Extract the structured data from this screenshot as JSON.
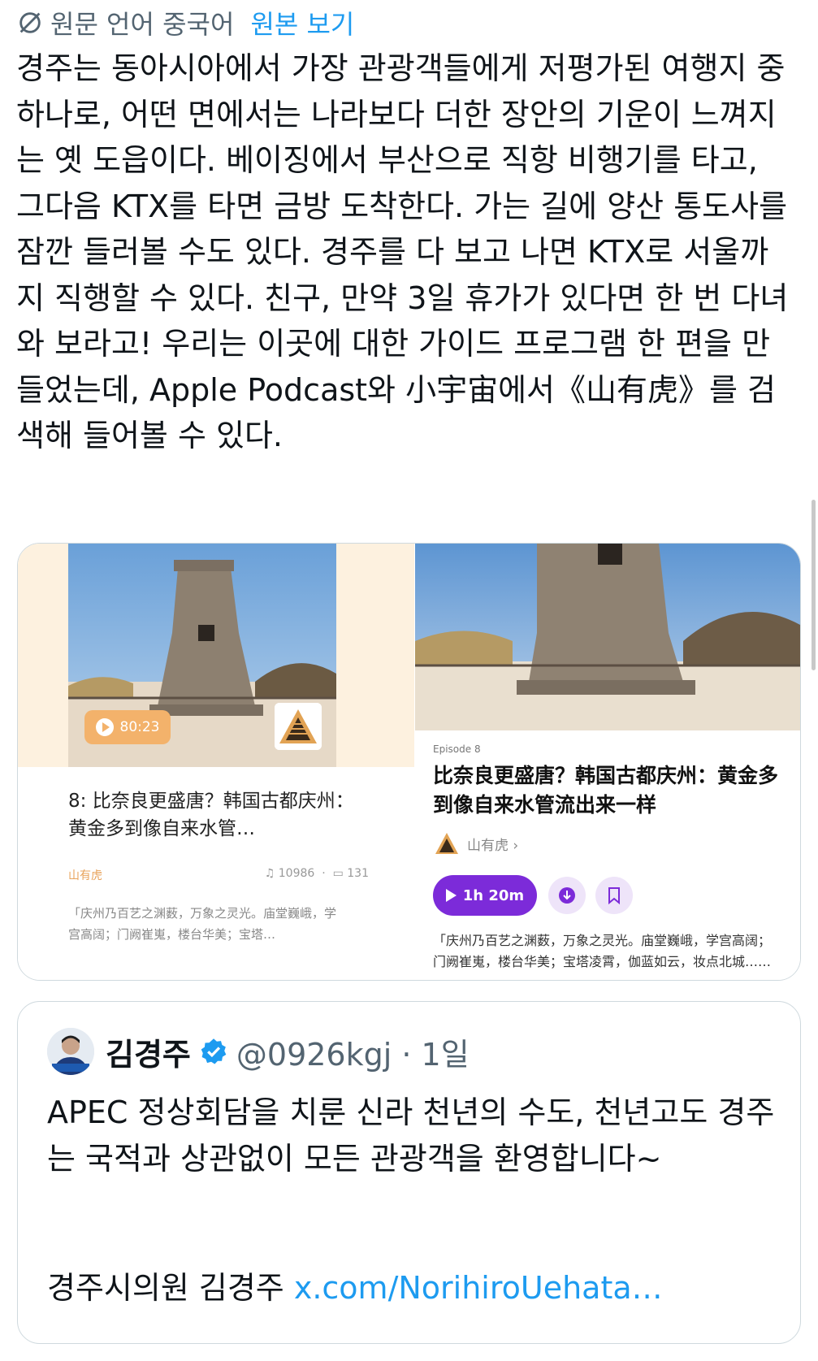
{
  "translation_bar": {
    "label": "원문 언어 중국어",
    "show_original": "원본 보기"
  },
  "post": {
    "text": "경주는 동아시아에서 가장 관광객들에게 저평가된 여행지 중 하나로, 어떤 면에서는 나라보다 더한 장안의 기운이 느껴지는 옛 도읍이다. 베이징에서 부산으로 직항 비행기를 타고, 그다음 KTX를 타면 금방 도착한다. 가는 길에 양산 통도사를 잠깐 들러볼 수도 있다. 경주를 다 보고 나면 KTX로 서울까지 직행할 수 있다. 친구, 만약 3일 휴가가 있다면 한 번 다녀와 보라고! 우리는 이곳에 대한 가이드 프로그램 한 편을 만들었는데, Apple Podcast와 小宇宙에서《山有虎》를 검색해 들어볼 수 있다."
  },
  "media": {
    "left": {
      "duration": "80:23",
      "title": "8: 比奈良更盛唐？韩国古都庆州：黄金多到像自来水管…",
      "brand": "山有虎",
      "listens": "10986",
      "comments": "131",
      "snippet": "「庆州乃百艺之渊薮，万象之灵光。庙堂巍峨，学宫高阔；门阙崔嵬，楼台华美；宝塔…"
    },
    "right": {
      "episode": "Episode 8",
      "title": "比奈良更盛唐？韩国古都庆州：黄金多到像自来水管流出来一样",
      "channel": "山有虎 ›",
      "play_label": "1h 20m",
      "snippet": "「庆州乃百艺之渊薮，万象之灵光。庙堂巍峨，学宫高阔；门阙崔嵬，楼台华美；宝塔凌霄，伽蓝如云，妆点北城……"
    }
  },
  "quote": {
    "name": "김경주",
    "handle": "@0926kgj · 1일",
    "text": "APEC 정상회담을 치룬 신라 천년의 수도, 천년고도 경주는 국적과 상관없이 모든 관광객을 환영합니다~",
    "sign_prefix": "경주시의원 김경주 ",
    "link": "x.com/NorihiroUehata…"
  },
  "colors": {
    "link": "#1d9bf0",
    "secondary_text": "#536471",
    "play_purple": "#7c2bd9",
    "pill_orange": "#f3b26b"
  },
  "icons": [
    "translate-icon",
    "play-icon",
    "download-icon",
    "bookmark-icon",
    "verified-badge-icon",
    "headphones-icon",
    "comment-icon"
  ]
}
